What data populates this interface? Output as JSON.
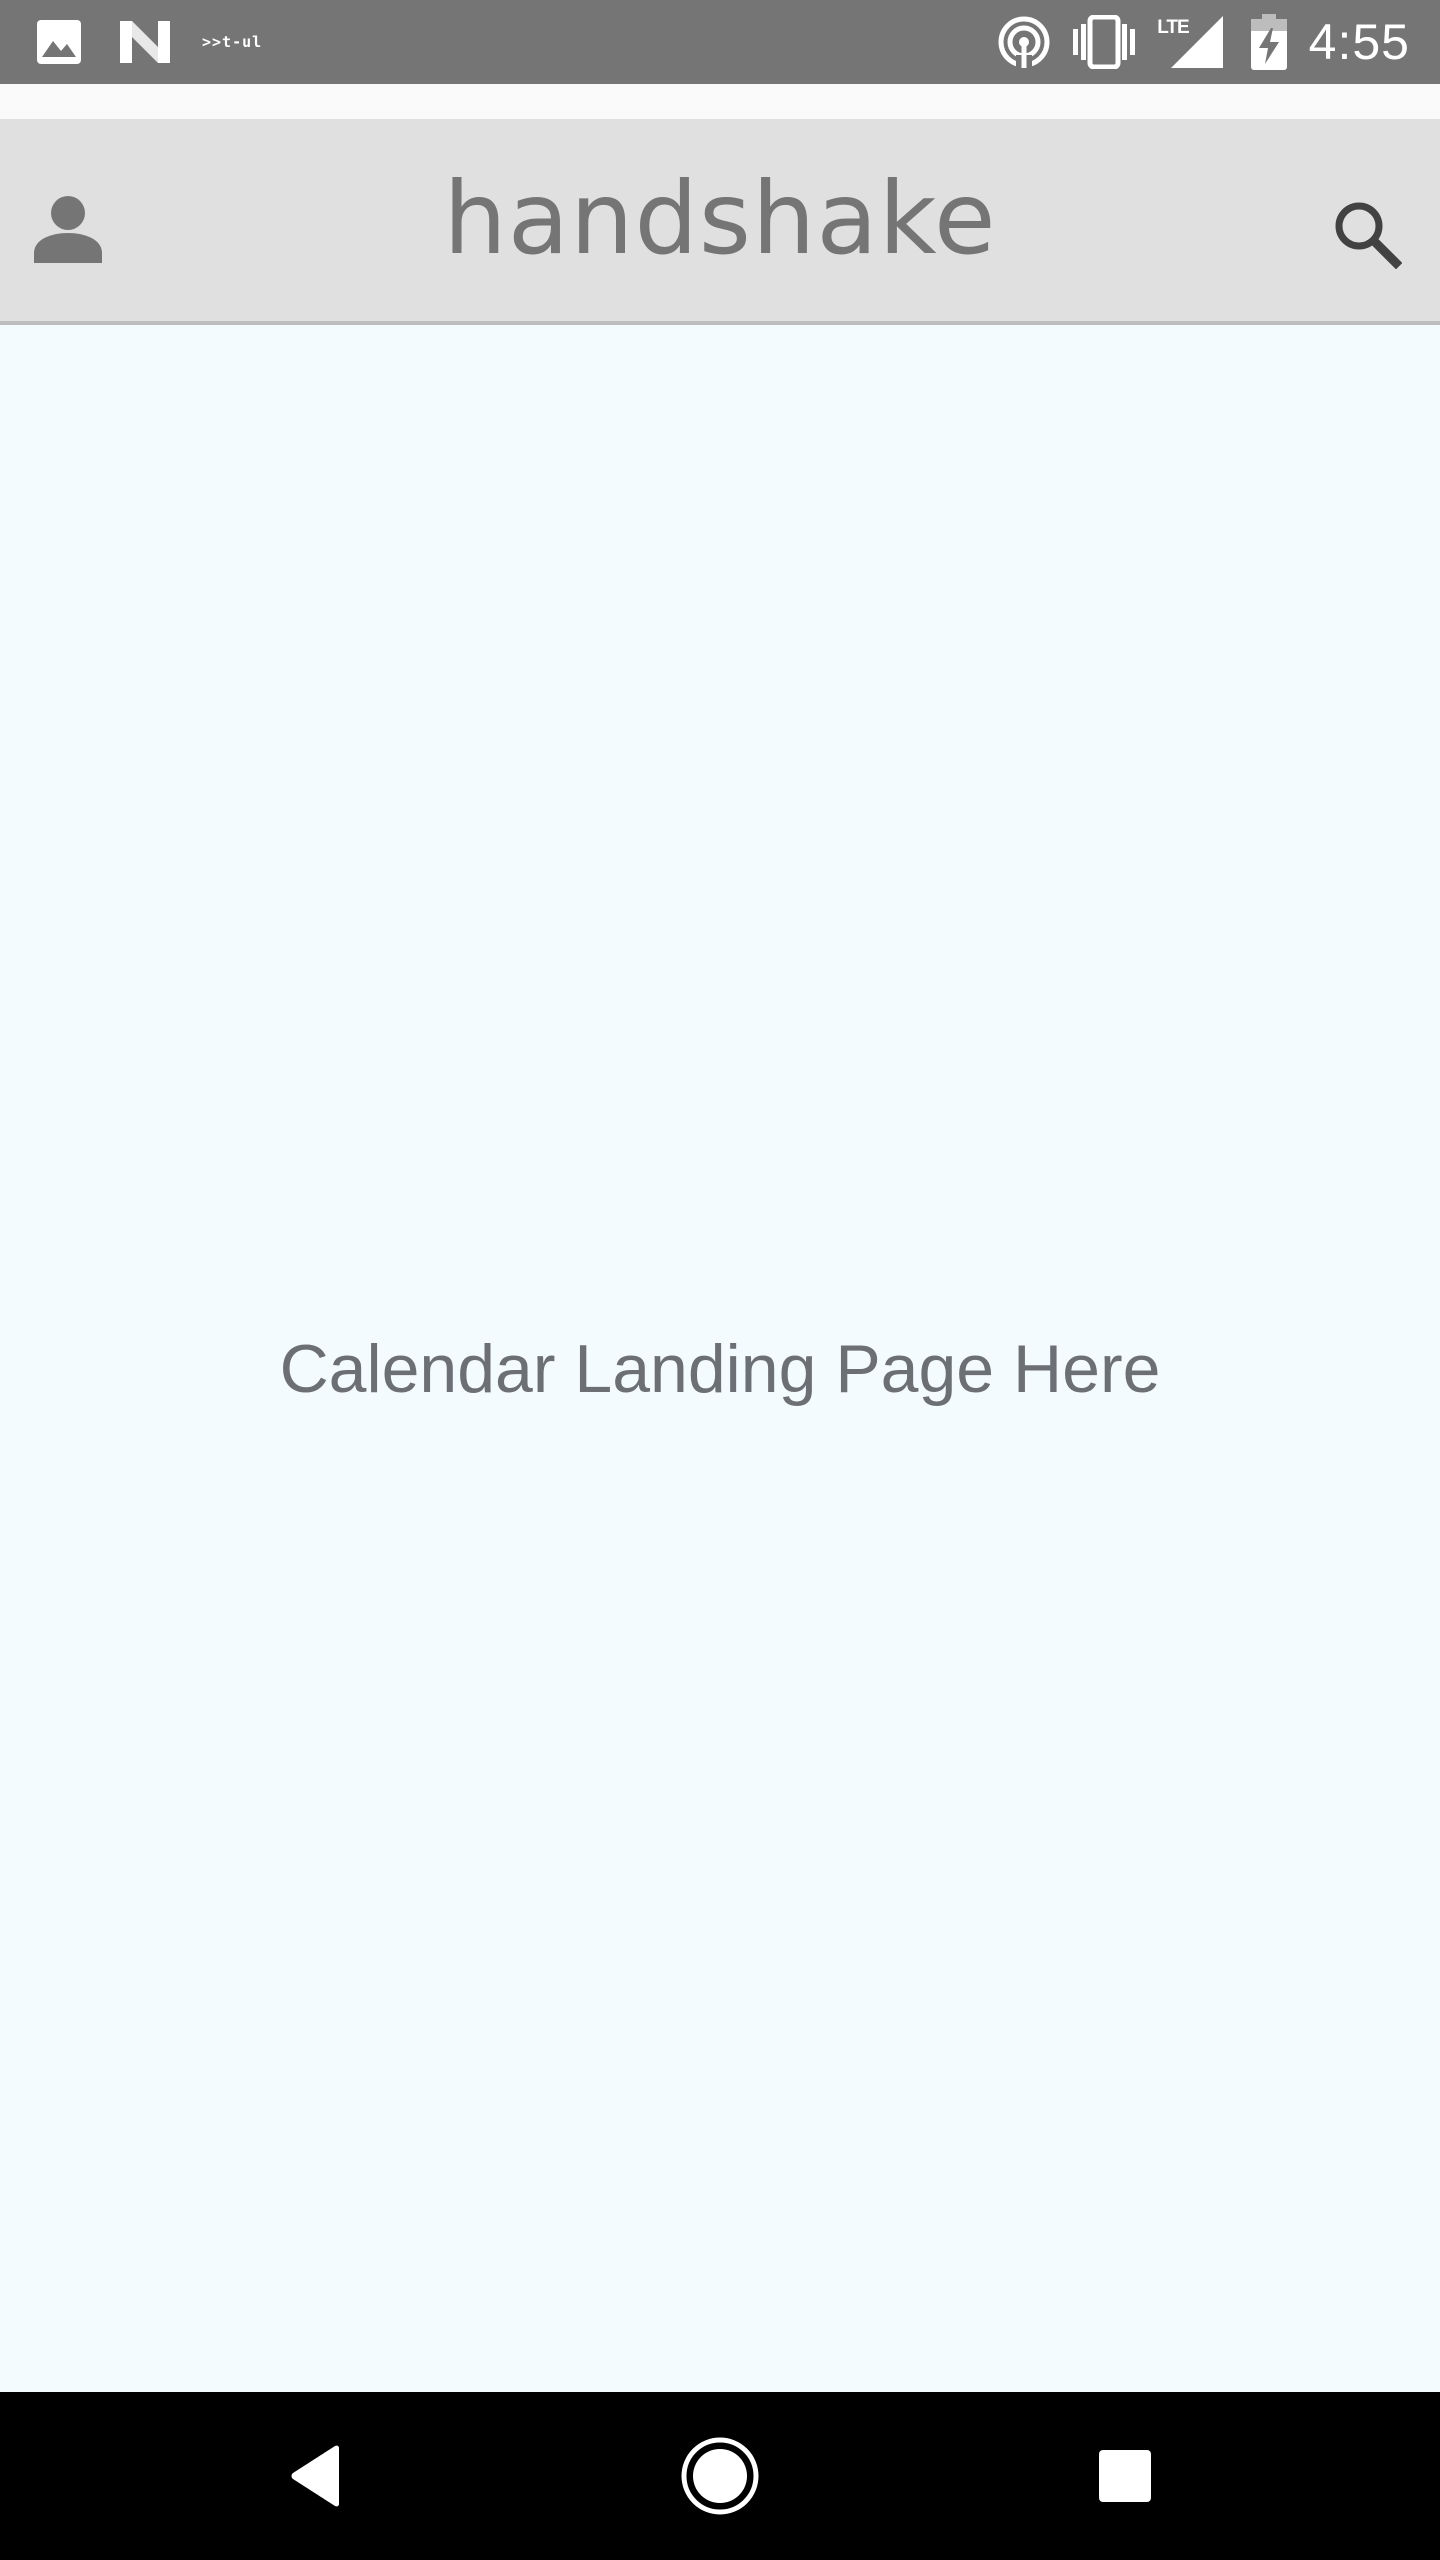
{
  "status_bar": {
    "debug_label": ">>t-ul",
    "lte_label": "LTE",
    "time": "4:55",
    "icons": [
      "image-icon",
      "n-logo-icon",
      "hotspot-icon",
      "vibrate-icon",
      "signal-icon",
      "battery-charging-icon"
    ]
  },
  "header": {
    "logo_text": "handshake",
    "profile_icon": "person-icon",
    "search_icon": "search-icon"
  },
  "main": {
    "placeholder": "Calendar Landing Page Here"
  },
  "nav_bar": {
    "icons": [
      "back-icon",
      "home-icon",
      "recents-icon"
    ]
  },
  "colors": {
    "status_bar_bg": "#757575",
    "header_bg": "#e0e0e0",
    "header_icon": "#757575",
    "content_bg": "#f4fbff",
    "placeholder_text": "#6c7075",
    "nav_bar_bg": "#000000"
  }
}
